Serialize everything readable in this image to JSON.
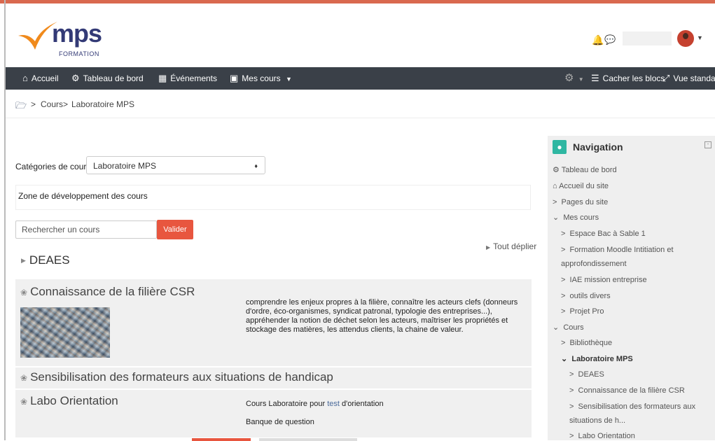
{
  "header": {
    "logo_word": "mps",
    "logo_sub": "FORMATION"
  },
  "navbar": {
    "items": [
      {
        "label": "Accueil",
        "icon": "home-icon"
      },
      {
        "label": "Tableau de bord",
        "icon": "dashboard-icon"
      },
      {
        "label": "Événements",
        "icon": "calendar-icon"
      },
      {
        "label": "Mes cours",
        "icon": "briefcase-icon"
      }
    ],
    "cacher_blocs": "Cacher les blocs",
    "vue_standard": "Vue standard"
  },
  "breadcrumb": {
    "items": [
      "Cours",
      "Laboratoire MPS"
    ]
  },
  "main": {
    "categories_label": "Catégories de cours:",
    "categories_selected": "Laboratoire MPS",
    "zone_text": "Zone de développement des cours",
    "search_placeholder": "Rechercher un cours",
    "search_button": "Valider",
    "expand_all": "Tout déplier",
    "section_title": "DEAES",
    "courses": [
      {
        "title": "Connaissance de la filière CSR",
        "summary": "comprendre les enjeux propres à la filière, connaître les acteurs clefs (donneurs d'ordre, éco-organismes, syndicat patronal, typologie des entreprises...), appréhender la notion de déchet selon les acteurs, maîtriser les propriétés et stockage des matières, les attendus clients, la chaine de valeur."
      },
      {
        "title": "Sensibilisation des formateurs aux situations de handicap"
      },
      {
        "title": "Labo Orientation",
        "summary_a": "Cours Laboratoire pour",
        "summary_link": "test",
        "summary_b": "d'orientation",
        "summary_2": "Banque de question"
      }
    ]
  },
  "sidebar": {
    "title": "Navigation",
    "items": [
      "Tableau de bord",
      "Accueil du site",
      "Pages du site",
      "Mes cours",
      "Espace Bac à Sable 1",
      "Formation Moodle Intitiation et",
      "approfondissement",
      "IAE mission entreprise",
      "outils divers",
      "Projet Pro",
      "Cours",
      "Bibliothèque",
      "Laboratoire MPS",
      "DEAES",
      "Connaissance de la filière CSR",
      "Sensibilisation des formateurs aux",
      "situations de h...",
      "Labo Orientation"
    ]
  }
}
